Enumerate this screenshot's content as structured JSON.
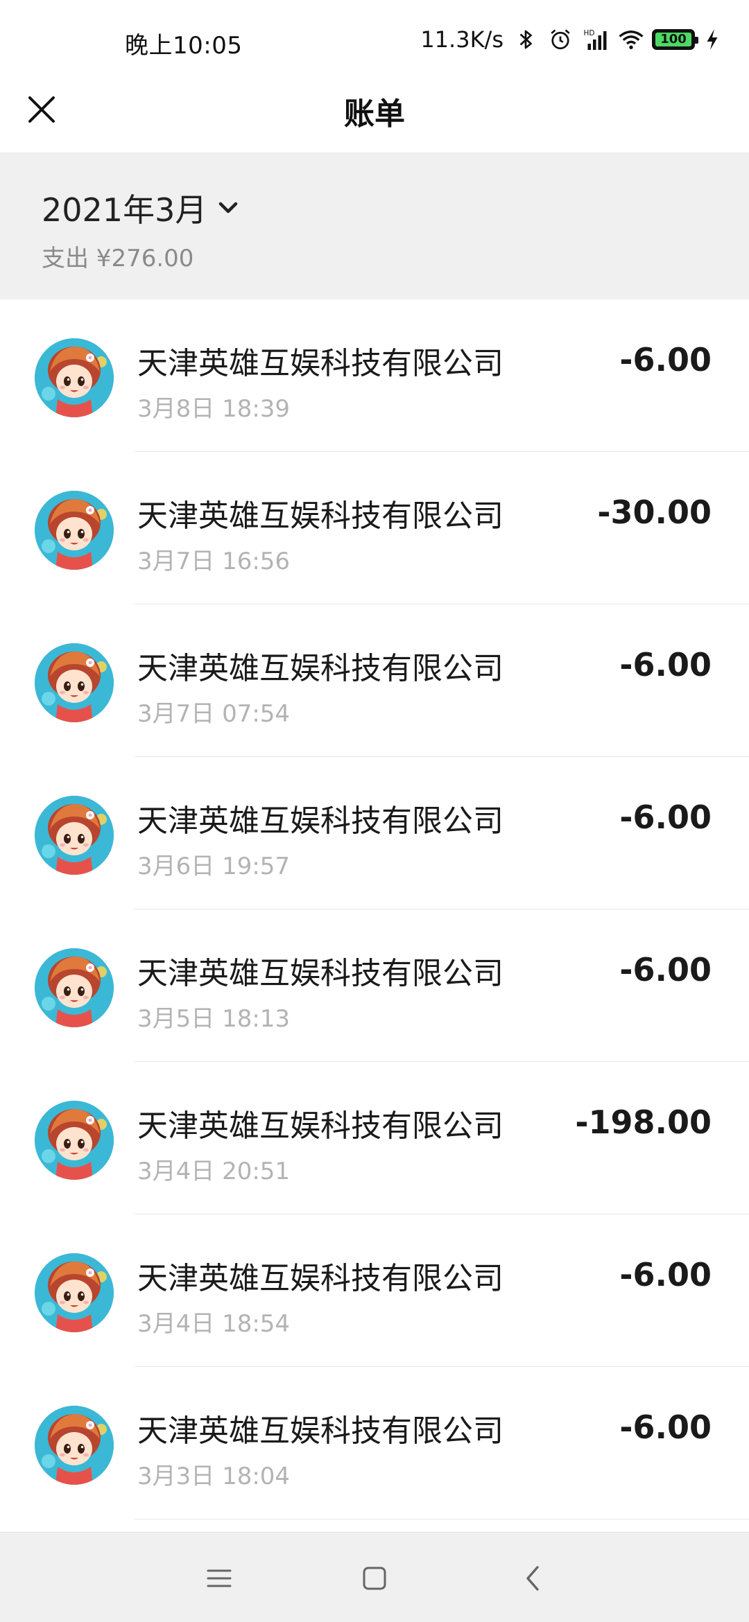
{
  "status_bar": {
    "time": "晚上10:05",
    "net_speed": "11.3K/s",
    "battery_level": "100",
    "icons": [
      "bluetooth-icon",
      "alarm-icon",
      "signal-hd-icon",
      "wifi-icon",
      "battery-icon",
      "charging-icon"
    ]
  },
  "header": {
    "title": "账单",
    "close_icon": "close-icon"
  },
  "month": {
    "label": "2021年3月",
    "expense": "支出 ¥276.00",
    "dropdown_icon": "chevron-down-icon"
  },
  "bills": [
    {
      "merchant": "天津英雄互娱科技有限公司",
      "time": "3月8日 18:39",
      "amount": "-6.00"
    },
    {
      "merchant": "天津英雄互娱科技有限公司",
      "time": "3月7日 16:56",
      "amount": "-30.00"
    },
    {
      "merchant": "天津英雄互娱科技有限公司",
      "time": "3月7日 07:54",
      "amount": "-6.00"
    },
    {
      "merchant": "天津英雄互娱科技有限公司",
      "time": "3月6日 19:57",
      "amount": "-6.00"
    },
    {
      "merchant": "天津英雄互娱科技有限公司",
      "time": "3月5日 18:13",
      "amount": "-6.00"
    },
    {
      "merchant": "天津英雄互娱科技有限公司",
      "time": "3月4日 20:51",
      "amount": "-198.00"
    },
    {
      "merchant": "天津英雄互娱科技有限公司",
      "time": "3月4日 18:54",
      "amount": "-6.00"
    },
    {
      "merchant": "天津英雄互娱科技有限公司",
      "time": "3月3日 18:04",
      "amount": "-6.00"
    }
  ],
  "nav_bar": {
    "icons": [
      "menu-icon",
      "home-icon",
      "back-icon"
    ]
  },
  "colors": {
    "header_bg": "#f0f0f0",
    "secondary_text": "#8a8a8a",
    "time_text": "#b3b3b3",
    "battery_green": "#4cd964"
  }
}
